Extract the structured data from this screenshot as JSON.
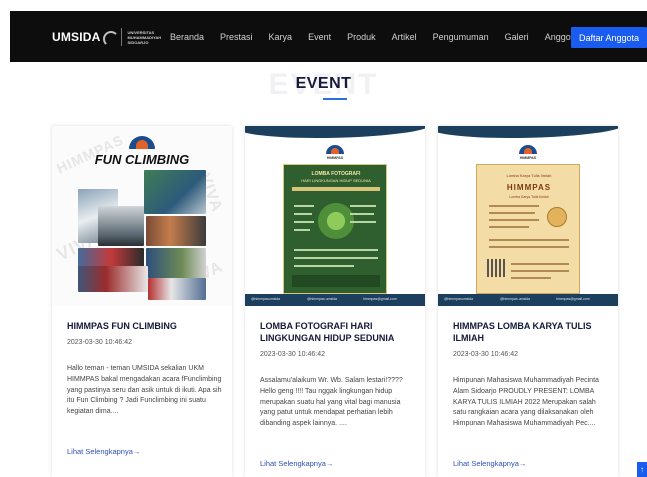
{
  "navbar": {
    "logo_text": "UMSIDA",
    "logo_subtext": "UNIVERSITAS MUHAMMADIYAH SIDOARJO",
    "links": [
      "Beranda",
      "Prestasi",
      "Karya",
      "Event",
      "Produk",
      "Artikel",
      "Pengumuman",
      "Galeri",
      "Anggota"
    ],
    "cta": "Daftar Anggota"
  },
  "section": {
    "ghost": "EVENT",
    "title": "EVENT"
  },
  "cards": [
    {
      "image": {
        "title": "FUN CLIMBING",
        "watermark_left": "HIMMPAS",
        "watermark_right": "VIVA"
      },
      "title": "HIMMPAS FUN CLIMBING",
      "date": "2023-03-30 10:46:42",
      "excerpt": "Hallo teman - teman UMSIDA sekalian UKM HIMMPAS bakal mengadakan acara fFunclimbing yang pastinya seru dan asik untuk di ikuti. Apa sih itu Fun Climbing ? Jadi Funclimbing ini suatu kegiatan dima....",
      "link": "Lihat Selengkapnya→"
    },
    {
      "image": {
        "brand": "HIMMPAS",
        "poster_title": "LOMBA FOTOGRAFI",
        "poster_subtitle": "HARI LINGKUNGAN HIDUP SEDUNIA",
        "footer_items": [
          "@himmpasumsida",
          "@himmpas.umsida",
          "himmpas@gmail.com"
        ]
      },
      "title": "LOMBA FOTOGRAFI HARI LINGKUNGAN HIDUP SEDUNIA",
      "date": "2023-03-30 10:46:42",
      "excerpt": "Assalamu'alaikum Wr. Wb. Salam lestari!???? Hello geng !!!! Tau nggak lingkungan hidup merupakan suatu hal yang vital bagi manusia yang patut untuk mendapat perhatian lebih dibanding aspek lainnya. ....",
      "link": "Lihat Selengkapnya→"
    },
    {
      "image": {
        "brand": "HIMMPAS",
        "poster_kicker": "Lomba Karya Tulis Ilmiah",
        "poster_title": "HIMMPAS",
        "poster_subtitle": "Lomba Karya Tulis Ilmiah",
        "footer_items": [
          "@himmpasumsida",
          "@himmpas.umsida",
          "himmpas@gmail.com"
        ]
      },
      "title": "HIMMPAS LOMBA KARYA TULIS ILMIAH",
      "date": "2023-03-30 10:46:42",
      "excerpt": "Himpunan Mahasiswa Muhammadiyah Pecinta Alam Sidoarjo PROUDLY PRESENT: LOMBA KARYA TULIS ILMIAH 2022 Merupakan salah satu rangkaian acara yang dilaksanakan oleh Himpunan Mahasiswa Muhammadiyah Pec....",
      "link": "Lihat Selengkapnya→"
    }
  ],
  "floating_button": "↑",
  "colors": {
    "navbar_bg": "#0d0d0d",
    "accent": "#1a5cf0",
    "title_navy": "#151a3c",
    "link": "#2f4fb5"
  }
}
